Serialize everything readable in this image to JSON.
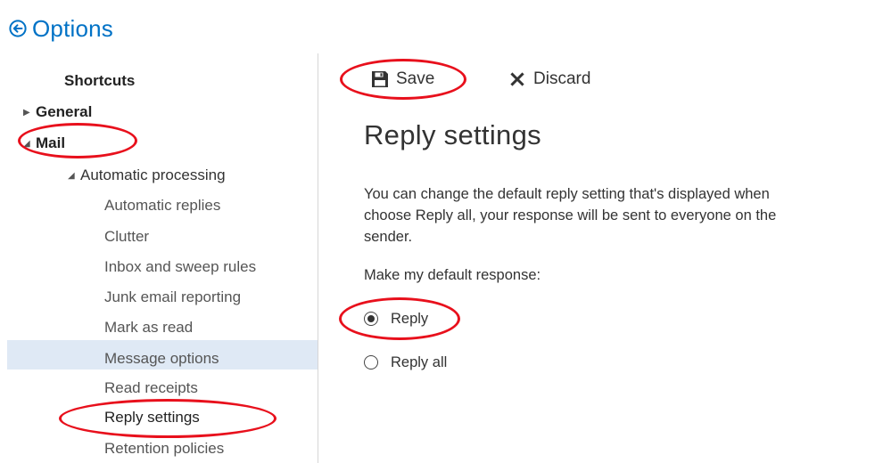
{
  "header": {
    "title": "Options",
    "back_icon": "back-arrow-circle-icon",
    "accent_color": "#0072c6"
  },
  "sidebar": {
    "items": [
      {
        "label": "Shortcuts"
      },
      {
        "label": "General"
      },
      {
        "label": "Mail"
      },
      {
        "label": "Automatic processing"
      },
      {
        "label": "Automatic replies"
      },
      {
        "label": "Clutter"
      },
      {
        "label": "Inbox and sweep rules"
      },
      {
        "label": "Junk email reporting"
      },
      {
        "label": "Mark as read"
      },
      {
        "label": "Message options"
      },
      {
        "label": "Read receipts"
      },
      {
        "label": "Reply settings"
      },
      {
        "label": "Retention policies"
      }
    ],
    "selected": "Reply settings",
    "selected_bg": "#dfe9f5"
  },
  "toolbar": {
    "save_label": "Save",
    "discard_label": "Discard"
  },
  "main": {
    "title": "Reply settings",
    "description_lines": [
      "You can change the default reply setting that's displayed when",
      "choose Reply all, your response will be sent to everyone on the",
      "sender."
    ],
    "prompt": "Make my default response:",
    "options": [
      {
        "label": "Reply",
        "checked": true
      },
      {
        "label": "Reply all",
        "checked": false
      }
    ]
  },
  "annotation_color": "#e8101c"
}
